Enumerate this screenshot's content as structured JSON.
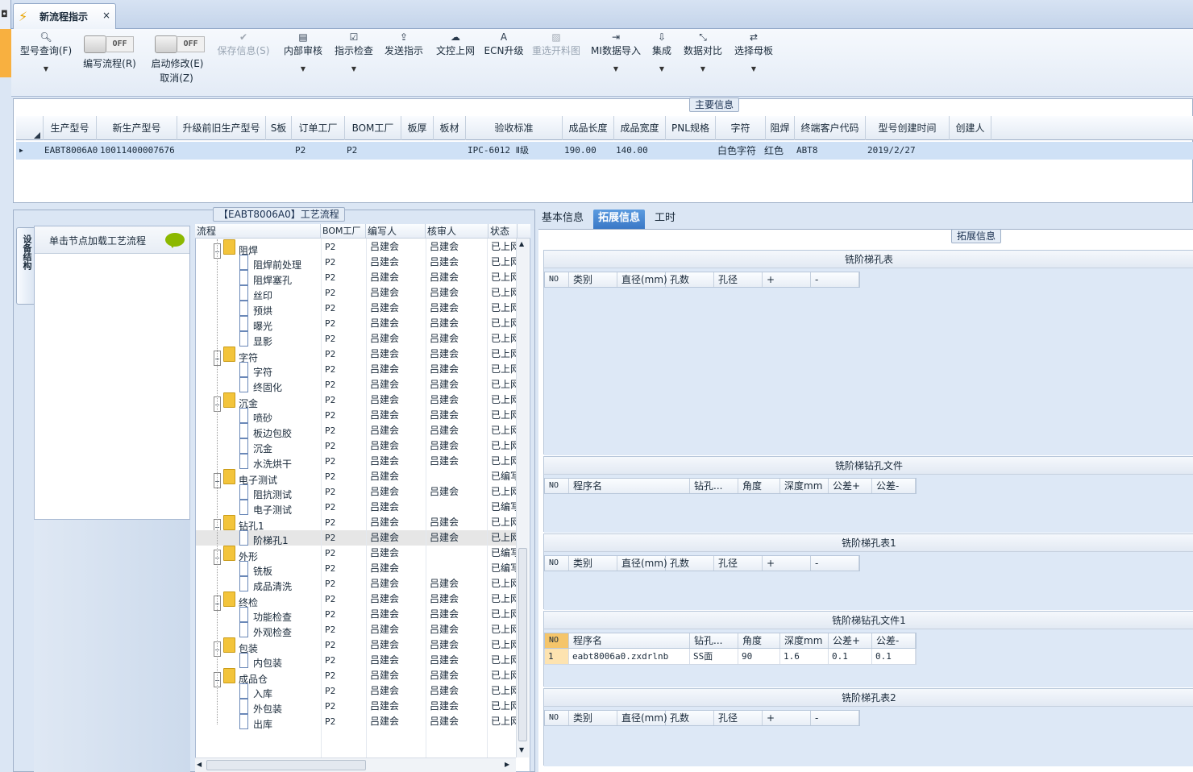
{
  "window": {
    "tab_title": "新流程指示",
    "left_tab_glyph": "◘"
  },
  "toolbar": {
    "query": "型号查询(F)",
    "toggle_off": "OFF",
    "edit_flow": "编写流程(R)",
    "start_modify": "启动修改(E)",
    "cancel": "取消(Z)",
    "save_info": "保存信息(S)",
    "internal_review": "内部审核",
    "indicate_check": "指示检查",
    "send_indicate": "发送指示",
    "doc_upload": "文控上网",
    "ecn_upgrade": "ECN升级",
    "reselect_cut": "重选开料图",
    "mi_import": "MI数据导入",
    "integrate": "集成",
    "data_compare": "数据对比",
    "select_master": "选择母板"
  },
  "main_info": {
    "label": "主要信息",
    "columns": [
      "生产型号",
      "新生产型号",
      "升级前旧生产型号",
      "S板",
      "订单工厂",
      "BOM工厂",
      "板厚",
      "板材",
      "验收标准",
      "成品长度",
      "成品宽度",
      "PNL规格",
      "字符",
      "阻焊",
      "终端客户代码",
      "型号创建时间",
      "创建人"
    ],
    "row": {
      "prod_model": "EABT8006A0",
      "new_model": "10011400007676",
      "old_model": "",
      "s_board": "",
      "order_factory": "P2",
      "bom_factory": "P2",
      "thickness": "",
      "material": "",
      "standard": "IPC-6012 Ⅱ级",
      "length": "190.00",
      "width": "140.00",
      "pnl": "",
      "char": "白色字符",
      "mask": "红色",
      "customer": "ABT8",
      "created": "2019/2/27",
      "creator": ""
    }
  },
  "left": {
    "vtab": "设备结构",
    "side_hint": "单击节点加载工艺流程",
    "flow_label": "【EABT8006A0】工艺流程",
    "tree_cols": [
      "流程",
      "BOM工厂",
      "编写人",
      "核审人",
      "状态"
    ],
    "rows": [
      {
        "name": "阻焊",
        "level": 0,
        "bom": "P2",
        "writer": "吕建会",
        "reviewer": "吕建会",
        "status": "已上网"
      },
      {
        "name": "阻焊前处理",
        "level": 1,
        "bom": "P2",
        "writer": "吕建会",
        "reviewer": "吕建会",
        "status": "已上网"
      },
      {
        "name": "阻焊塞孔",
        "level": 1,
        "bom": "P2",
        "writer": "吕建会",
        "reviewer": "吕建会",
        "status": "已上网"
      },
      {
        "name": "丝印",
        "level": 1,
        "bom": "P2",
        "writer": "吕建会",
        "reviewer": "吕建会",
        "status": "已上网"
      },
      {
        "name": "预烘",
        "level": 1,
        "bom": "P2",
        "writer": "吕建会",
        "reviewer": "吕建会",
        "status": "已上网"
      },
      {
        "name": "曝光",
        "level": 1,
        "bom": "P2",
        "writer": "吕建会",
        "reviewer": "吕建会",
        "status": "已上网"
      },
      {
        "name": "显影",
        "level": 1,
        "bom": "P2",
        "writer": "吕建会",
        "reviewer": "吕建会",
        "status": "已上网"
      },
      {
        "name": "字符",
        "level": 0,
        "bom": "P2",
        "writer": "吕建会",
        "reviewer": "吕建会",
        "status": "已上网"
      },
      {
        "name": "字符",
        "level": 1,
        "bom": "P2",
        "writer": "吕建会",
        "reviewer": "吕建会",
        "status": "已上网"
      },
      {
        "name": "终固化",
        "level": 1,
        "bom": "P2",
        "writer": "吕建会",
        "reviewer": "吕建会",
        "status": "已上网"
      },
      {
        "name": "沉金",
        "level": 0,
        "bom": "P2",
        "writer": "吕建会",
        "reviewer": "吕建会",
        "status": "已上网"
      },
      {
        "name": "喷砂",
        "level": 1,
        "bom": "P2",
        "writer": "吕建会",
        "reviewer": "吕建会",
        "status": "已上网"
      },
      {
        "name": "板边包胶",
        "level": 1,
        "bom": "P2",
        "writer": "吕建会",
        "reviewer": "吕建会",
        "status": "已上网"
      },
      {
        "name": "沉金",
        "level": 1,
        "bom": "P2",
        "writer": "吕建会",
        "reviewer": "吕建会",
        "status": "已上网"
      },
      {
        "name": "水洗烘干",
        "level": 1,
        "bom": "P2",
        "writer": "吕建会",
        "reviewer": "吕建会",
        "status": "已上网"
      },
      {
        "name": "电子测试",
        "level": 0,
        "bom": "P2",
        "writer": "吕建会",
        "reviewer": "",
        "status": "已编写"
      },
      {
        "name": "阻抗测试",
        "level": 1,
        "bom": "P2",
        "writer": "吕建会",
        "reviewer": "吕建会",
        "status": "已上网"
      },
      {
        "name": "电子测试",
        "level": 1,
        "bom": "P2",
        "writer": "吕建会",
        "reviewer": "",
        "status": "已编写"
      },
      {
        "name": "钻孔1",
        "level": 0,
        "bom": "P2",
        "writer": "吕建会",
        "reviewer": "吕建会",
        "status": "已上网"
      },
      {
        "name": "阶梯孔1",
        "level": 1,
        "bom": "P2",
        "writer": "吕建会",
        "reviewer": "吕建会",
        "status": "已上网",
        "selected": true
      },
      {
        "name": "外形",
        "level": 0,
        "bom": "P2",
        "writer": "吕建会",
        "reviewer": "",
        "status": "已编写"
      },
      {
        "name": "铣板",
        "level": 1,
        "bom": "P2",
        "writer": "吕建会",
        "reviewer": "",
        "status": "已编写"
      },
      {
        "name": "成品清洗",
        "level": 1,
        "bom": "P2",
        "writer": "吕建会",
        "reviewer": "吕建会",
        "status": "已上网"
      },
      {
        "name": "终检",
        "level": 0,
        "bom": "P2",
        "writer": "吕建会",
        "reviewer": "吕建会",
        "status": "已上网"
      },
      {
        "name": "功能检查",
        "level": 1,
        "bom": "P2",
        "writer": "吕建会",
        "reviewer": "吕建会",
        "status": "已上网"
      },
      {
        "name": "外观检查",
        "level": 1,
        "bom": "P2",
        "writer": "吕建会",
        "reviewer": "吕建会",
        "status": "已上网"
      },
      {
        "name": "包装",
        "level": 0,
        "bom": "P2",
        "writer": "吕建会",
        "reviewer": "吕建会",
        "status": "已上网"
      },
      {
        "name": "内包装",
        "level": 1,
        "bom": "P2",
        "writer": "吕建会",
        "reviewer": "吕建会",
        "status": "已上网"
      },
      {
        "name": "成品仓",
        "level": 0,
        "bom": "P2",
        "writer": "吕建会",
        "reviewer": "吕建会",
        "status": "已上网"
      },
      {
        "name": "入库",
        "level": 1,
        "bom": "P2",
        "writer": "吕建会",
        "reviewer": "吕建会",
        "status": "已上网"
      },
      {
        "name": "外包装",
        "level": 1,
        "bom": "P2",
        "writer": "吕建会",
        "reviewer": "吕建会",
        "status": "已上网"
      },
      {
        "name": "出库",
        "level": 1,
        "bom": "P2",
        "writer": "吕建会",
        "reviewer": "吕建会",
        "status": "已上网"
      }
    ]
  },
  "right": {
    "tabs": [
      "基本信息",
      "拓展信息",
      "工时"
    ],
    "active_tab": 1,
    "group_label": "拓展信息",
    "hole_cols": [
      "NO",
      "类别",
      "直径(mm)",
      "孔数",
      "孔径",
      "+",
      "-"
    ],
    "file_cols": [
      "NO",
      "程序名",
      "钻孔...",
      "角度",
      "深度mm",
      "公差+",
      "公差-"
    ],
    "sections": [
      {
        "title": "铣阶梯孔表",
        "kind": "hole",
        "rows": []
      },
      {
        "title": "铣阶梯钻孔文件",
        "kind": "file",
        "rows": []
      },
      {
        "title": "铣阶梯孔表1",
        "kind": "hole",
        "rows": []
      },
      {
        "title": "铣阶梯钻孔文件1",
        "kind": "file",
        "rows": [
          [
            "1",
            "eabt8006a0.zxdrlnb",
            "SS面",
            "90",
            "1.6",
            "0.1",
            "0.1"
          ]
        ]
      },
      {
        "title": "铣阶梯孔表2",
        "kind": "hole",
        "rows": []
      }
    ]
  }
}
